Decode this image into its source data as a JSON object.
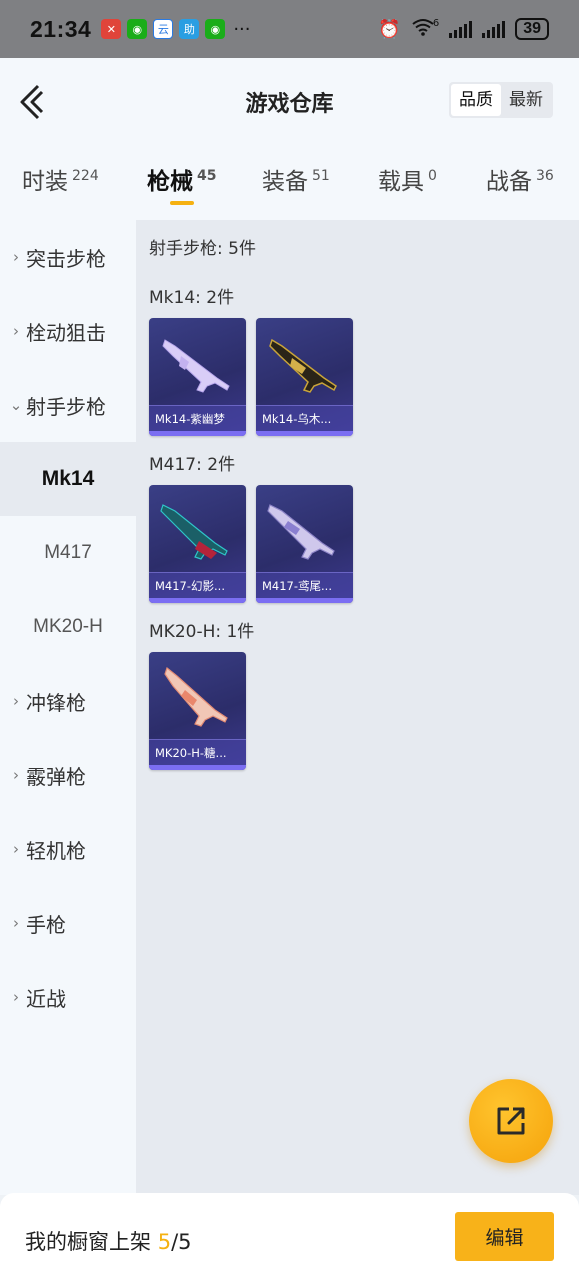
{
  "status_bar": {
    "time": "21:34",
    "battery": "39",
    "more": "···",
    "network_label": "6"
  },
  "header": {
    "title": "游戏仓库",
    "sort_options": [
      "品质",
      "最新"
    ]
  },
  "tabs": [
    {
      "label": "时装",
      "count": "224"
    },
    {
      "label": "枪械",
      "count": "45"
    },
    {
      "label": "装备",
      "count": "51"
    },
    {
      "label": "载具",
      "count": "0"
    },
    {
      "label": "战备",
      "count": "36"
    }
  ],
  "sidebar": {
    "categories": [
      {
        "label": "突击步枪",
        "chevron": "›"
      },
      {
        "label": "栓动狙击",
        "chevron": "›"
      },
      {
        "label": "射手步枪",
        "chevron": "⌄"
      },
      {
        "label": "冲锋枪",
        "chevron": "›"
      },
      {
        "label": "霰弹枪",
        "chevron": "›"
      },
      {
        "label": "轻机枪",
        "chevron": "›"
      },
      {
        "label": "手枪",
        "chevron": "›"
      },
      {
        "label": "近战",
        "chevron": "›"
      }
    ],
    "subcategories": [
      "Mk14",
      "M417",
      "MK20-H"
    ]
  },
  "content": {
    "summary": "射手步枪: 5件",
    "groups": [
      {
        "title": "Mk14: 2件",
        "items": [
          "Mk14-紫幽梦",
          "Mk14-乌木..."
        ]
      },
      {
        "title": "M417: 2件",
        "items": [
          "M417-幻影...",
          "M417-鸢尾..."
        ]
      },
      {
        "title": "MK20-H: 1件",
        "items": [
          "MK20-H-糖..."
        ]
      }
    ]
  },
  "bottom_bar": {
    "label": "我的橱窗上架",
    "current": "5",
    "total": "/5",
    "edit_label": "编辑"
  },
  "icons": {
    "back": "back-chevron-icon",
    "fab": "share-external-icon"
  },
  "colors": {
    "accent": "#f5b111",
    "card_bg": "#2f3175",
    "card_base": "#7b6ef2"
  }
}
